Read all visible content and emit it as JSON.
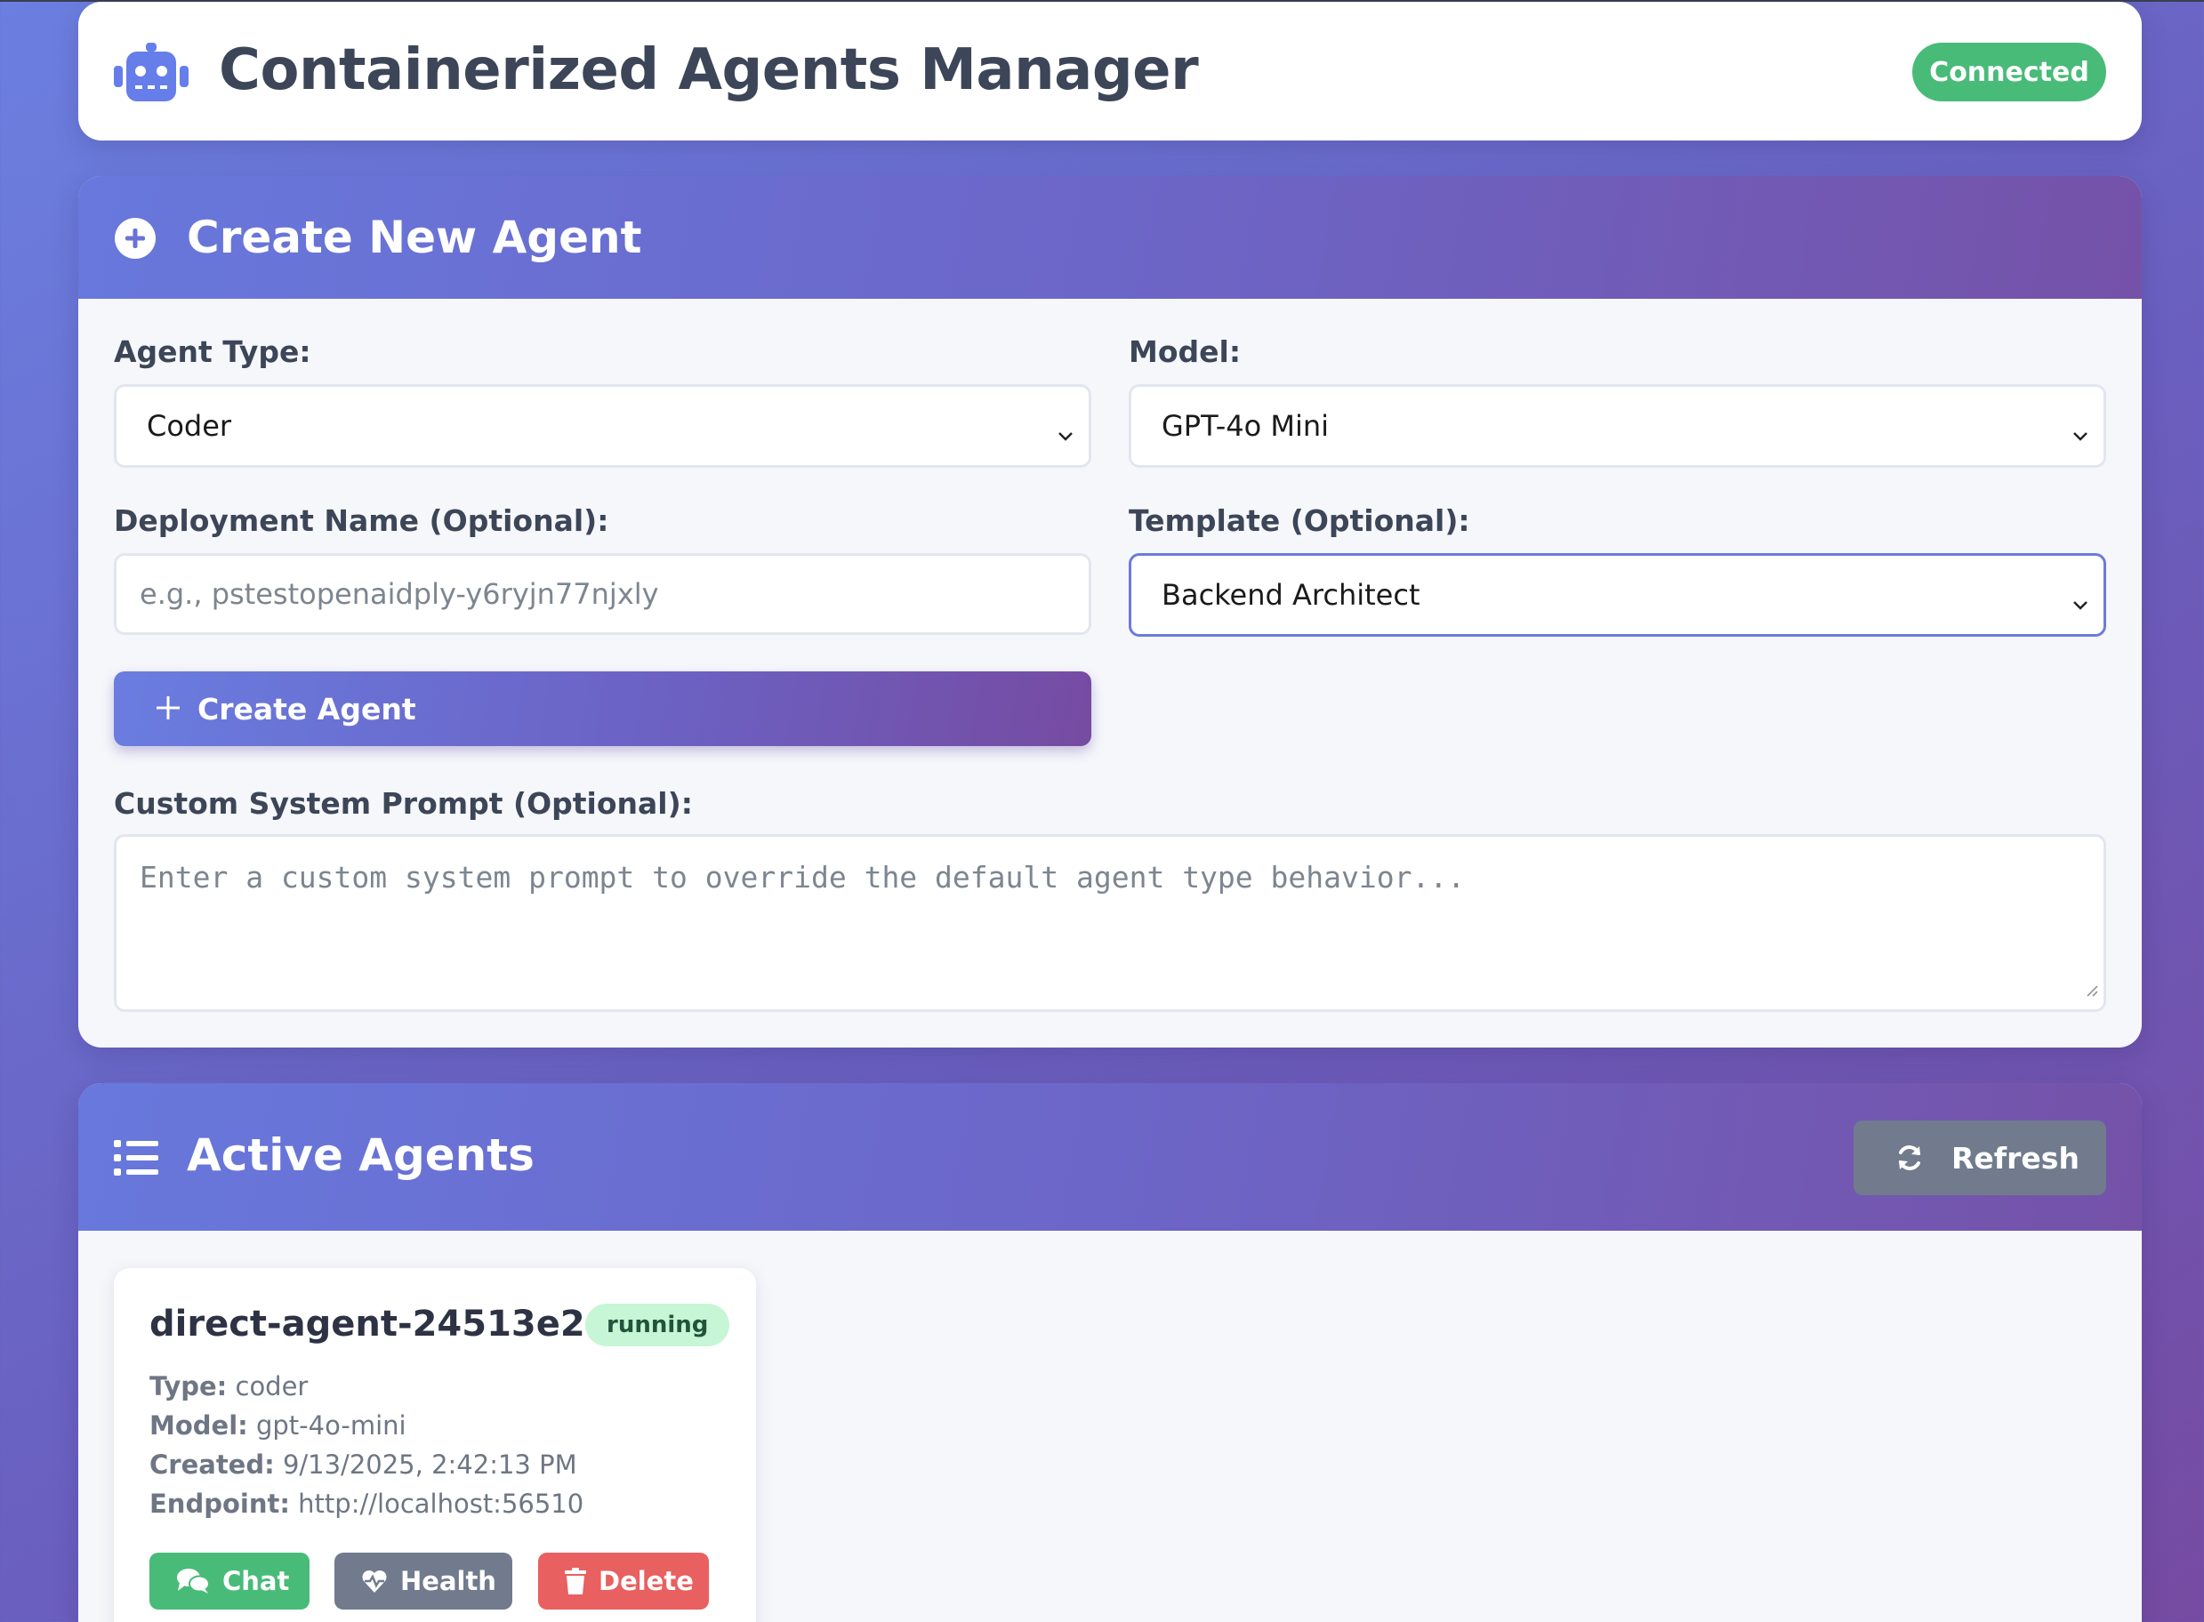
{
  "header": {
    "title": "Containerized Agents Manager",
    "status": "Connected",
    "status_color": "#48bb78",
    "icon": "robot-icon"
  },
  "create": {
    "title": "Create New Agent",
    "icon": "plus-circle-icon",
    "agent_type_label": "Agent Type:",
    "agent_type_value": "Coder",
    "model_label": "Model:",
    "model_value": "GPT-4o Mini",
    "deployment_label": "Deployment Name (Optional):",
    "deployment_placeholder": "e.g., pstestopenaidply-y6ryjn77njxly",
    "template_label": "Template (Optional):",
    "template_value": "Backend Architect",
    "create_button": "Create Agent",
    "prompt_label": "Custom System Prompt (Optional):",
    "prompt_placeholder": "Enter a custom system prompt to override the default agent type behavior..."
  },
  "active": {
    "title": "Active Agents",
    "icon": "list-icon",
    "refresh_button": "Refresh",
    "agents": [
      {
        "name": "direct-agent-24513e2c",
        "status": "running",
        "type_label": "Type:",
        "type": "coder",
        "model_label": "Model:",
        "model": "gpt-4o-mini",
        "created_label": "Created:",
        "created": "9/13/2025, 2:42:13 PM",
        "endpoint_label": "Endpoint:",
        "endpoint": "http://localhost:56510",
        "chat_button": "Chat",
        "health_button": "Health",
        "delete_button": "Delete"
      }
    ]
  },
  "colors": {
    "accent_start": "#667eea",
    "accent_end": "#764ba2",
    "success": "#48bb78",
    "danger": "#e86060",
    "neutral": "#717b8d"
  }
}
